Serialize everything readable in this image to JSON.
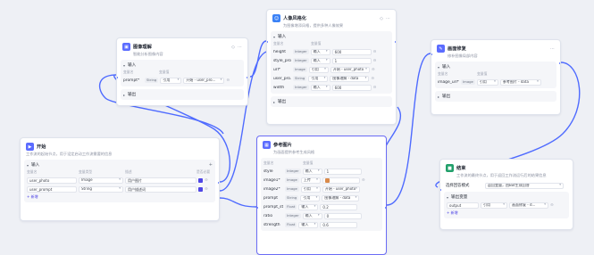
{
  "nodes": {
    "start": {
      "title": "开始",
      "desc": "工作流的起始节点，用于设定启动工作流需要的信息",
      "input_label": "输入",
      "col_name": "变量名",
      "col_type": "变量类型",
      "col_desc": "描述",
      "col_required": "是否必要",
      "rows": [
        {
          "name": "user_photo",
          "type": "Image",
          "desc": "用户图片"
        },
        {
          "name": "user_prompt",
          "type": "String",
          "desc": "用户描述词"
        }
      ],
      "add_label": "新增"
    },
    "image_understand": {
      "title": "图像理解",
      "desc": "智能分析图像内容",
      "input_label": "输入",
      "col_name": "变量名",
      "col_value": "变量值",
      "rows": [
        {
          "name": "prompt*",
          "type": "String",
          "mode": "引用",
          "value": "开始 - user_pro..."
        }
      ],
      "output_label": "输出"
    },
    "photo_stylize": {
      "title": "人像风格化",
      "desc": "为图像增添风格，提供多种人像效果",
      "input_label": "输入",
      "col_name": "变量名",
      "col_value": "变量值",
      "rows": [
        {
          "name": "height",
          "type": "Integer",
          "mode": "输入",
          "value": "600"
        },
        {
          "name": "style_pro...",
          "type": "Integer",
          "mode": "输入",
          "value": "1"
        },
        {
          "name": "url*",
          "type": "Image",
          "mode": "引用",
          "value": "开始 - user_photo"
        },
        {
          "name": "user_pro...",
          "type": "String",
          "mode": "引用",
          "value": "图像理解 - data"
        },
        {
          "name": "width",
          "type": "Integer",
          "mode": "输入",
          "value": "600"
        }
      ],
      "output_label": "输出"
    },
    "image_repair": {
      "title": "画面修复",
      "desc": "修补图像局部内容",
      "input_label": "输入",
      "col_name": "变量名",
      "col_value": "变量值",
      "rows": [
        {
          "name": "image_url*",
          "type": "Image",
          "mode": "引用",
          "value": "参考图片 - data"
        }
      ],
      "output_label": "输出"
    },
    "ref_image": {
      "title": "参考图片",
      "desc": "为画面提供参考生成风格",
      "col_name": "变量名",
      "col_value": "变量值",
      "rows": [
        {
          "name": "style",
          "type": "Integer",
          "mode": "输入",
          "value": "1"
        },
        {
          "name": "image1*",
          "type": "Image",
          "mode": "上传",
          "value": ""
        },
        {
          "name": "image2*",
          "type": "Image",
          "mode": "引用",
          "value": "开始 - user_photo"
        },
        {
          "name": "prompt",
          "type": "String",
          "mode": "引用",
          "value": "图像理解 - data"
        },
        {
          "name": "prompt_str...",
          "type": "Float",
          "mode": "输入",
          "value": "0.2"
        },
        {
          "name": "ratio",
          "type": "Integer",
          "mode": "输入",
          "value": "0"
        },
        {
          "name": "strength",
          "type": "Float",
          "mode": "输入",
          "value": "0.6"
        }
      ]
    },
    "end": {
      "title": "结束",
      "desc": "工作流的最终节点，用于返回工作流运行后的结果信息",
      "return_label": "选择回答模式",
      "return_value": "返回变量，由Bot生成回答",
      "output_label": "输出变量",
      "rows": [
        {
          "name": "output",
          "mode": "引用",
          "value": "画面修复 - d..."
        }
      ],
      "add_label": "新增"
    }
  },
  "colors": {
    "accent": "#5b6cff",
    "wire": "#4f6bff",
    "selected_border": "#6b6cf5",
    "canvas": "#eef0f5"
  },
  "icons": {
    "more": "more-dots-icon",
    "info": "info-icon",
    "chevron": "chevron-down-icon"
  }
}
